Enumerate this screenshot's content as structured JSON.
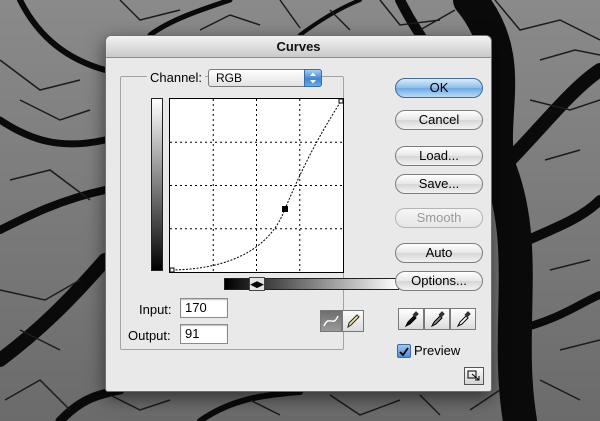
{
  "dialog": {
    "title": "Curves",
    "channel": {
      "label": "Channel:",
      "value": "RGB"
    },
    "input": {
      "label": "Input:",
      "value": "170"
    },
    "output": {
      "label": "Output:",
      "value": "91"
    },
    "buttons": {
      "ok": "OK",
      "cancel": "Cancel",
      "load": "Load...",
      "save": "Save...",
      "smooth": "Smooth",
      "auto": "Auto",
      "options": "Options..."
    },
    "preview": {
      "label": "Preview",
      "checked": true
    },
    "curve": {
      "selected_point": {
        "input": 170,
        "output": 91
      },
      "range": [
        0,
        255
      ]
    },
    "tools": [
      "curve-tool-icon",
      "pencil-icon"
    ],
    "eyedroppers": [
      "black-eyedropper-icon",
      "gray-eyedropper-icon",
      "white-eyedropper-icon"
    ]
  },
  "colors": {
    "default_button": "#8ebde9",
    "dialog_bg": "#e9e9e9"
  }
}
